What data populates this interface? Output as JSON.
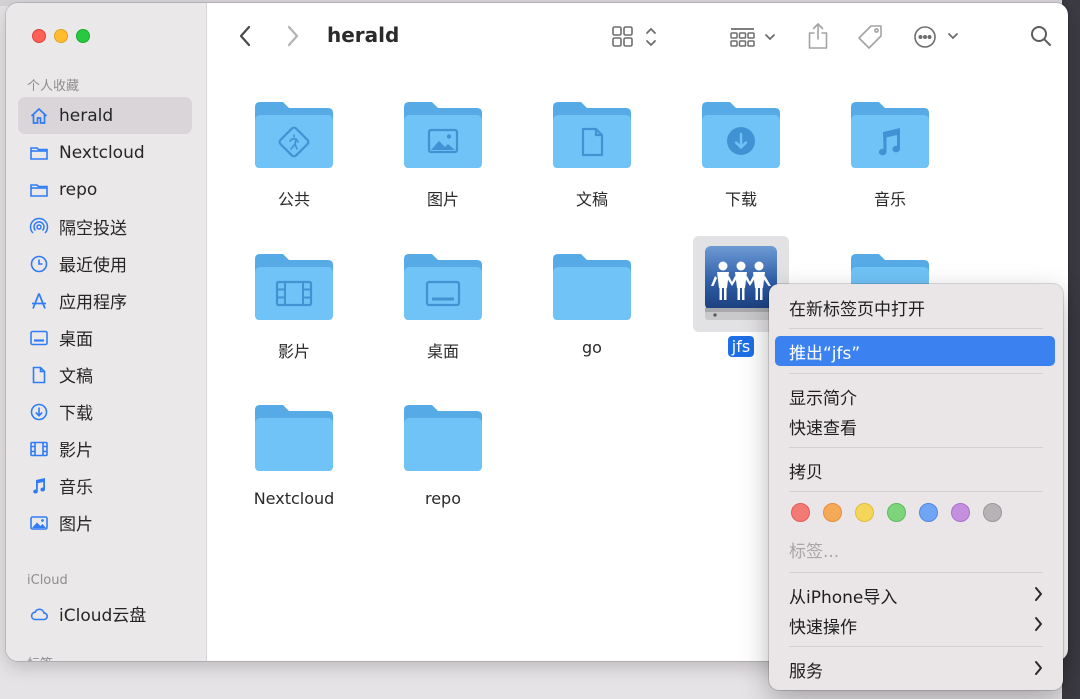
{
  "window": {
    "title": "herald"
  },
  "sidebar": {
    "favorites_label": "个人收藏",
    "icloud_label": "iCloud",
    "tags_label": "标签",
    "favorites": [
      {
        "label": "herald",
        "icon": "home-icon",
        "active": true
      },
      {
        "label": "Nextcloud",
        "icon": "folder-icon"
      },
      {
        "label": "repo",
        "icon": "folder-icon"
      },
      {
        "label": "隔空投送",
        "icon": "airdrop-icon"
      },
      {
        "label": "最近使用",
        "icon": "clock-icon"
      },
      {
        "label": "应用程序",
        "icon": "applications-icon"
      },
      {
        "label": "桌面",
        "icon": "desktop-icon"
      },
      {
        "label": "文稿",
        "icon": "document-icon"
      },
      {
        "label": "下载",
        "icon": "download-icon"
      },
      {
        "label": "影片",
        "icon": "film-icon"
      },
      {
        "label": "音乐",
        "icon": "music-icon"
      },
      {
        "label": "图片",
        "icon": "photo-icon"
      }
    ],
    "icloud": [
      {
        "label": "iCloud云盘",
        "icon": "cloud-icon"
      }
    ]
  },
  "files": [
    {
      "label": "公共",
      "emblem": "public"
    },
    {
      "label": "图片",
      "emblem": "photo"
    },
    {
      "label": "文稿",
      "emblem": "document"
    },
    {
      "label": "下载",
      "emblem": "download"
    },
    {
      "label": "音乐",
      "emblem": "music"
    },
    {
      "label": "影片",
      "emblem": "film"
    },
    {
      "label": "桌面",
      "emblem": "desktop"
    },
    {
      "label": "go",
      "emblem": "none"
    },
    {
      "label": "jfs",
      "emblem": "network-disk",
      "selected": true
    },
    {
      "label": "",
      "emblem": "none"
    },
    {
      "label": "Nextcloud",
      "emblem": "none"
    },
    {
      "label": "repo",
      "emblem": "none"
    }
  ],
  "context_menu": {
    "open_in_new_tab": "在新标签页中打开",
    "eject": "推出“jfs”",
    "get_info": "显示简介",
    "quick_look": "快速查看",
    "copy": "拷贝",
    "tags": "标签...",
    "import_from_iphone": "从iPhone导入",
    "quick_actions": "快速操作",
    "services": "服务",
    "tag_colors": [
      {
        "name": "red",
        "fill": "#f47a75",
        "stroke": "#e25b55"
      },
      {
        "name": "orange",
        "fill": "#f7a95a",
        "stroke": "#e58e3b"
      },
      {
        "name": "yellow",
        "fill": "#f6d65a",
        "stroke": "#e1bd3a"
      },
      {
        "name": "green",
        "fill": "#7ed47a",
        "stroke": "#5cbc58"
      },
      {
        "name": "blue",
        "fill": "#6fa5f2",
        "stroke": "#4c88e6"
      },
      {
        "name": "purple",
        "fill": "#c58fe0",
        "stroke": "#ab6fcc"
      },
      {
        "name": "gray",
        "fill": "#b5b3b5",
        "stroke": "#999799"
      }
    ]
  },
  "colors": {
    "accent": "#1e6fe6",
    "folder": "#6ec0f5",
    "menu_highlight": "#3b82f0"
  }
}
